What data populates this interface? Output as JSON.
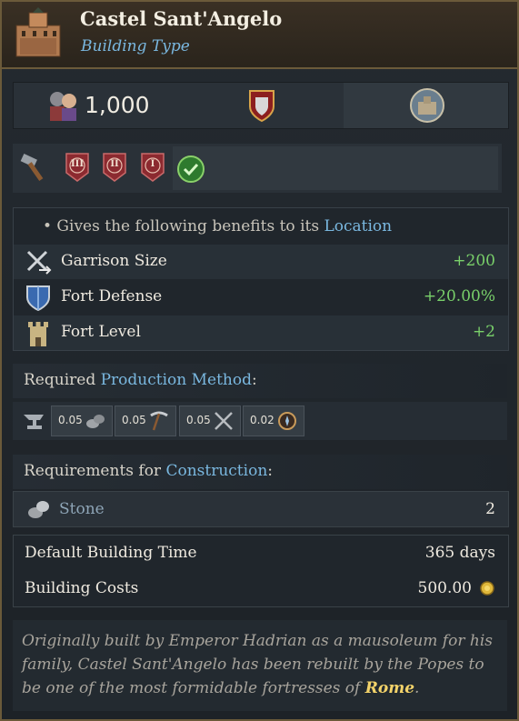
{
  "header": {
    "title": "Castel Sant'Angelo",
    "subtitle": "Building Type",
    "icon": "castle-building-icon"
  },
  "summary": {
    "cost_value": "1,000",
    "cost_icon": "soldiers-icon",
    "shield_icon": "red-shield-icon",
    "location_icon": "fortress-portrait-icon"
  },
  "levels": {
    "tool_icon": "hammer-icon",
    "badges": [
      "III",
      "II",
      "I"
    ],
    "check_icon": "green-check-icon"
  },
  "benefits": {
    "intro_prefix": "• Gives the following benefits to its ",
    "intro_link": "Location",
    "items": [
      {
        "label": "Garrison Size",
        "value": "+200",
        "icon": "crossed-swords-icon"
      },
      {
        "label": "Fort Defense",
        "value": "+20.00%",
        "icon": "shield-icon"
      },
      {
        "label": "Fort Level",
        "value": "+2",
        "icon": "tower-icon"
      }
    ]
  },
  "production": {
    "heading_prefix": "Required ",
    "heading_link": "Production Method",
    "heading_suffix": ":",
    "icon": "anvil-icon",
    "chips": [
      {
        "value": "0.05",
        "icon": "stone-icon"
      },
      {
        "value": "0.05",
        "icon": "pickaxe-icon"
      },
      {
        "value": "0.05",
        "icon": "crossed-tools-icon"
      },
      {
        "value": "0.02",
        "icon": "compass-icon"
      }
    ]
  },
  "construction": {
    "heading_prefix": "Requirements for ",
    "heading_link": "Construction",
    "heading_suffix": ":",
    "resource_label": "Stone",
    "resource_value": "2",
    "resource_icon": "stone-icon"
  },
  "info": {
    "time_label": "Default Building Time",
    "time_value": "365 days",
    "cost_label": "Building Costs",
    "cost_value": "500.00",
    "coin_icon": "gold-coin-icon"
  },
  "flavor": {
    "text": "Originally built by Emperor Hadrian as a mausoleum for his family, Castel Sant'Angelo has been rebuilt by the Popes to be one of the most formidable fortresses of ",
    "highlight": "Rome",
    "end": "."
  }
}
